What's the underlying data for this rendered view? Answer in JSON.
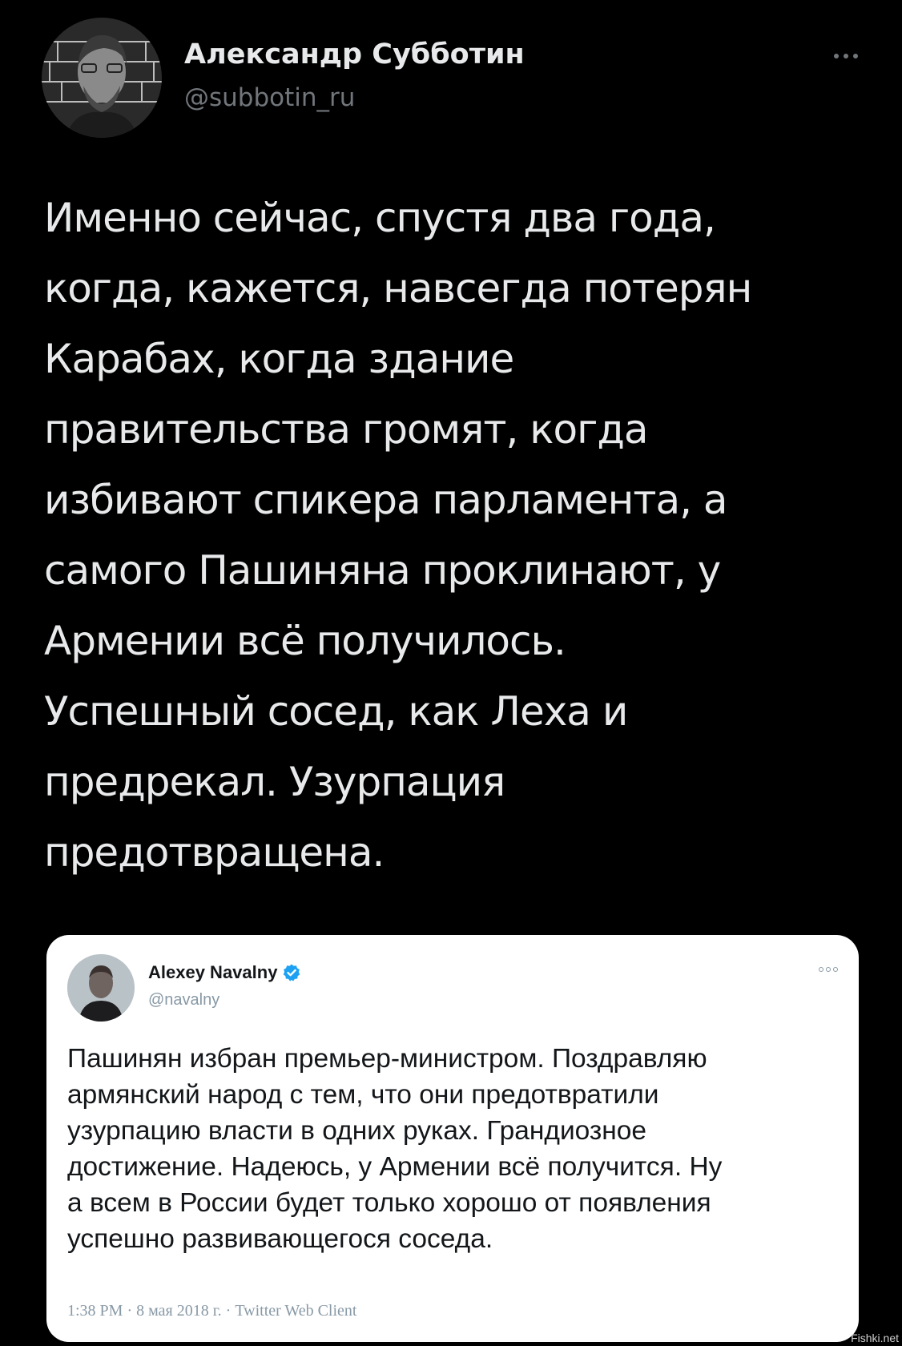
{
  "tweet": {
    "author": {
      "name": "Александр Субботин",
      "handle": "@subbotin_ru",
      "avatar_icon": "person-photo-icon"
    },
    "more_icon": "more-options-icon",
    "text": "Именно сейчас, спустя два года,\nкогда, кажется, навсегда потерян\nКарабах, когда здание\nправительства громят, когда\nизбивают спикера парламента, а\nсамого Пашиняна проклинают, у\nАрмении всё получилось.\nУспешный сосед, как Леха и\nпредрекал. Узурпация\nпредотвращена."
  },
  "quote": {
    "author": {
      "name": "Alexey Navalny",
      "handle": "@navalny",
      "verified_icon": "verified-badge-icon"
    },
    "text": "Пашинян избран премьер-министром. Поздравляю\nармянский народ с тем, что они предотвратили\nузурпацию власти в одних руках. Грандиозное\nдостижение. Надеюсь, у Армении всё получится. Ну\nа всем в России будет только хорошо от появления\nуспешно развивающегося соседа.",
    "meta": "1:38 PM · 8 мая 2018 г. · Twitter Web Client"
  },
  "watermark": "Fishki.net",
  "colors": {
    "background": "#000000",
    "text_primary": "#e7e9ea",
    "text_secondary": "#71767b",
    "card_background": "#ffffff",
    "verified_blue": "#1da1f2"
  }
}
